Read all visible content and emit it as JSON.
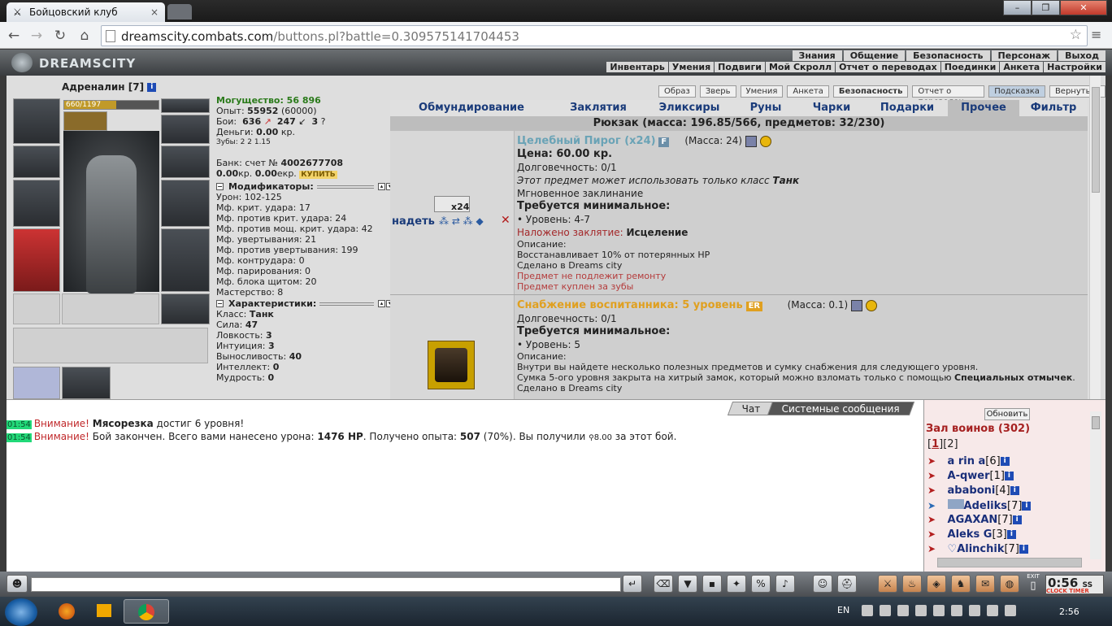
{
  "browser": {
    "tab_title": "Бойцовский клуб",
    "tab_close": "×",
    "url_host": "dreamscity.combats.com",
    "url_rest": "/buttons.pl?battle=0.309575141704453",
    "window_buttons": [
      "–",
      "❐",
      "✕"
    ]
  },
  "site": {
    "logo": "DREAMSCITY",
    "menu_top": [
      "Знания",
      "Общение",
      "Безопасность",
      "Персонаж",
      "Выход"
    ],
    "menu_bottom": [
      "Инвентарь",
      "Умения",
      "Подвиги",
      "Мой Скролл",
      "Отчет о переводах",
      "Поединки",
      "Анкета",
      "Настройки"
    ]
  },
  "character": {
    "name": "Адреналин",
    "level": "[7]",
    "hp": "660/1197",
    "hp_fraction": 0.55,
    "power": "Могущество: 56 896",
    "exp_label": "Опыт:",
    "exp": "55952",
    "exp_next": "(60000)",
    "fights_label": "Бои:",
    "wins": "636",
    "losses": "247",
    "draws": "3",
    "money_label": "Деньги:",
    "money": "0.00",
    "money_unit": "кр.",
    "teeth_label": "Зубы:",
    "teeth": "2  2  1.15",
    "bank_label": "Банк: счет №",
    "bank_account": "4002677708",
    "bank_kr": "0.00",
    "bank_ekr": "0.00",
    "bank_unit_kr": "кр.",
    "bank_unit_ekr": "екр.",
    "buy": "КУПИТЬ"
  },
  "modifiers": {
    "title": "Модификаторы:",
    "rows": [
      "Урон: 102-125",
      "Мф. крит. удара: 17",
      "Мф. против крит. удара: 24",
      "Мф. против мощ. крит. удара: 42",
      "Мф. увертывания: 21",
      "Мф. против увертывания: 199",
      "Мф. контрудара: 0",
      "Мф. парирования: 0",
      "Мф. блока щитом: 20",
      "Мастерство: 8"
    ]
  },
  "characteristics": {
    "title": "Характеристики:",
    "rows": [
      {
        "label": "Класс: ",
        "value": "Танк"
      },
      {
        "label": "Сила: ",
        "value": "47"
      },
      {
        "label": "Ловкость: ",
        "value": "3"
      },
      {
        "label": "Интуиция: ",
        "value": "3"
      },
      {
        "label": "Выносливость: ",
        "value": "40"
      },
      {
        "label": "Интеллект: ",
        "value": "0"
      },
      {
        "label": "Мудрость: ",
        "value": "0"
      }
    ]
  },
  "top_buttons": [
    "Образ",
    "Зверь",
    "Умения",
    "Анкета",
    "Безопасность",
    "Отчет о переводах",
    "Подсказка",
    "Вернуться"
  ],
  "inventory_tabs": [
    "Обмундирование",
    "Заклятия",
    "Эликсиры",
    "Руны",
    "Чарки",
    "Подарки",
    "Прочее",
    "Фильтр"
  ],
  "active_tab": "Прочее",
  "backpack": "Рюкзак (масса: 196.85/566, предметов: 32/230)",
  "items": [
    {
      "name": "Целебный Пирог (x24)",
      "tag": "F",
      "mass": "(Масса: 24)",
      "count": "x24",
      "wear": "надеть",
      "price": "Цена: 60.00 кр.",
      "durability": "Долговечность: 0/1",
      "class_req_prefix": "Этот предмет может использовать только класс ",
      "class_req_value": "Танк",
      "instant": "Мгновенное заклинание",
      "req_title": "Требуется минимальное:",
      "req_level": "• Уровень: 4-7",
      "spell_label": "Наложено заклятие: ",
      "spell_value": "Исцеление",
      "desc_title": "Описание:",
      "desc": "Восстанавливает 10% от потерянных HP",
      "made": "Сделано в Dreams city",
      "note1": "Предмет не подлежит ремонту",
      "note2": "Предмет куплен за зубы"
    },
    {
      "name": "Снабжение воспитанника: 5 уровень",
      "tag": "ER",
      "mass": "(Масса: 0.1)",
      "durability": "Долговечность: 0/1",
      "req_title": "Требуется минимальное:",
      "req_level": "• Уровень: 5",
      "desc_title": "Описание:",
      "desc1": "Внутри вы найдете несколько полезных предметов и сумку снабжения для следующего уровня.",
      "desc2_prefix": "Сумка 5-ого уровня закрыта на хитрый замок, который можно взломать только с помощью ",
      "desc2_bold": "Специальных отмычек",
      "desc2_suffix": ".",
      "made": "Сделано в Dreams city"
    }
  ],
  "chat": {
    "tabs": [
      "Чат",
      "Системные сообщения"
    ],
    "messages": [
      {
        "time": "01:54",
        "warn": "Внимание!",
        "bold": "Мясорезка",
        "text": " достиг 6 уровня!"
      },
      {
        "time": "01:54",
        "warn": "Внимание!",
        "text1": " Бой закончен. Всего вами нанесено урона: ",
        "dmg": "1476 HP",
        "text2": ". Получено опыта: ",
        "exp": "507",
        "text3": " (70%). Вы получили ",
        "coins": "8.00",
        "text4": " за этот бой."
      }
    ]
  },
  "online": {
    "refresh": "Обновить",
    "hall": "Зал воинов (302)",
    "page_current": "1",
    "page_other": "[2]",
    "users": [
      {
        "name": "a rin a",
        "level": "[6]"
      },
      {
        "name": "A-qwer",
        "level": "[1]"
      },
      {
        "name": "ababoni",
        "level": "[4]"
      },
      {
        "name": "Adeliks",
        "level": "[7]"
      },
      {
        "name": "AGAXAN",
        "level": "[7]"
      },
      {
        "name": "Aleks G",
        "level": "[3]"
      },
      {
        "name": "Alinchik",
        "level": "[7]"
      }
    ]
  },
  "bottom": {
    "clock": "0:56",
    "clock_suffix": "SS",
    "clock_labels": "CLOCK TIMER",
    "exit": "EXIT"
  },
  "taskbar": {
    "lang": "EN",
    "time": "2:56"
  }
}
